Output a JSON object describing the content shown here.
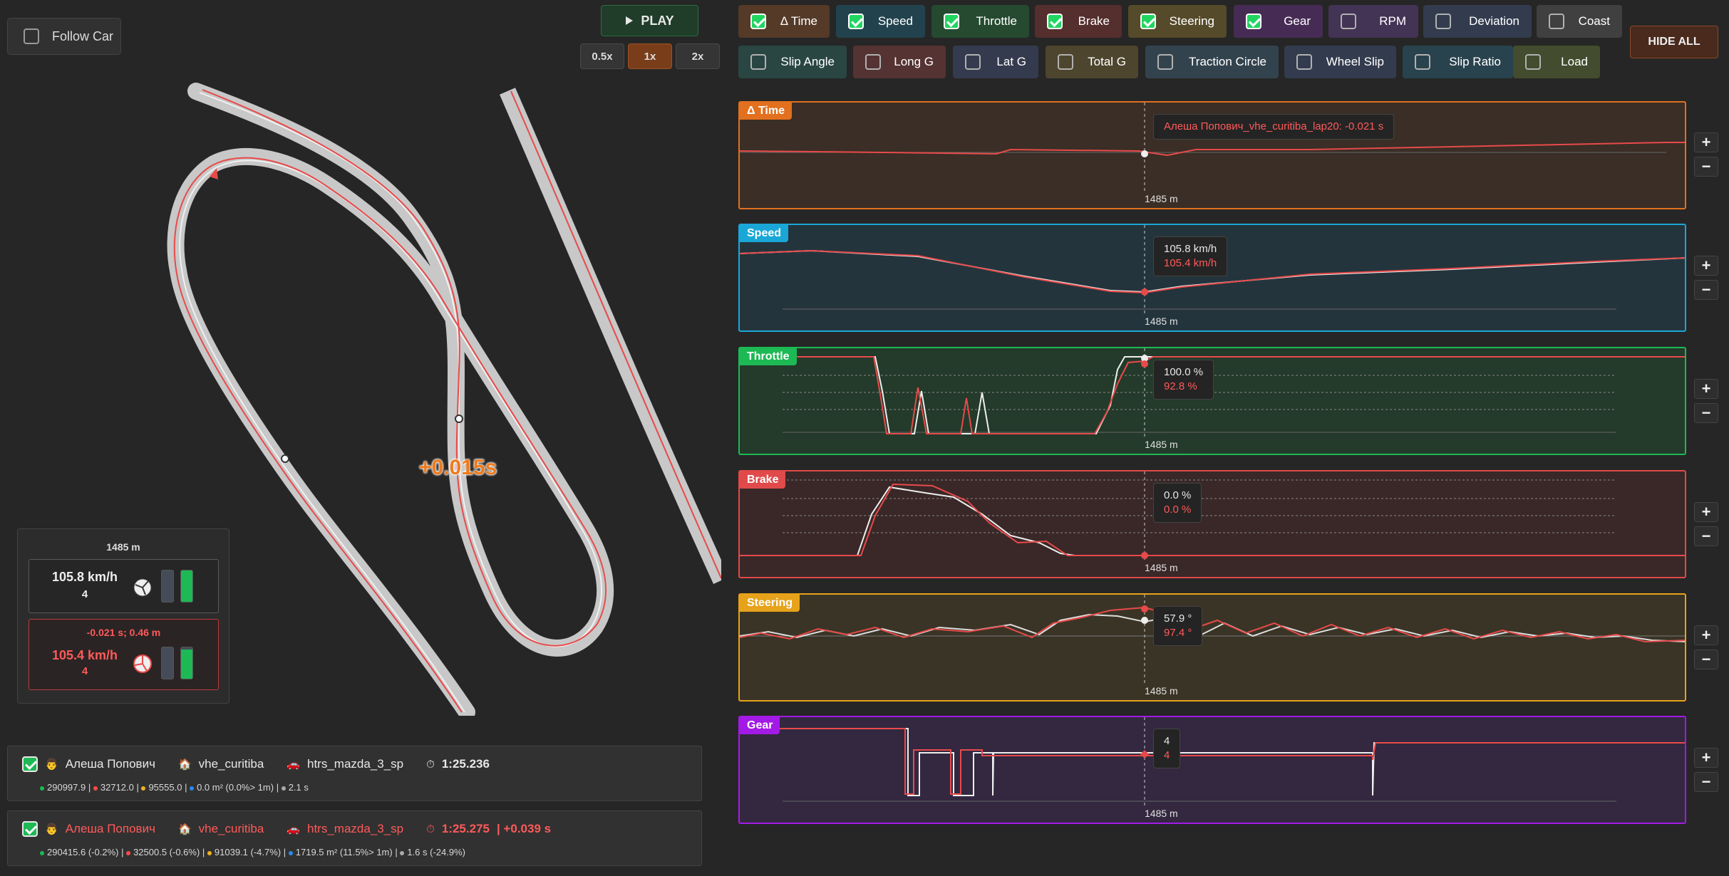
{
  "controls": {
    "follow_car_label": "Follow Car",
    "play_label": "PLAY",
    "play_icon": "play-icon",
    "speeds": [
      "0.5x",
      "1x",
      "2x"
    ],
    "active_speed": "1x",
    "hide_all_label": "HIDE ALL"
  },
  "channels": [
    {
      "label": "Δ Time",
      "checked": true,
      "color": "#4a3222"
    },
    {
      "label": "Speed",
      "checked": true,
      "color": "#1e3a44"
    },
    {
      "label": "Throttle",
      "checked": true,
      "color": "#20402a"
    },
    {
      "label": "Brake",
      "checked": true,
      "color": "#4a2828"
    },
    {
      "label": "Steering",
      "checked": true,
      "color": "#4a4024"
    },
    {
      "label": "Gear",
      "checked": true,
      "color": "#3d2649"
    },
    {
      "label": "RPM",
      "checked": false,
      "color": "#3a2c4a"
    },
    {
      "label": "Deviation",
      "checked": false,
      "color": "#2c3444"
    },
    {
      "label": "Coast",
      "checked": false,
      "color": "#383838"
    },
    {
      "label": "Slip Angle",
      "checked": false,
      "color": "#243d3a"
    },
    {
      "label": "Long G",
      "checked": false,
      "color": "#4a2c2c"
    },
    {
      "label": "Lat G",
      "checked": false,
      "color": "#2d3344"
    },
    {
      "label": "Total G",
      "checked": false,
      "color": "#443c28"
    },
    {
      "label": "Traction Circle",
      "checked": false,
      "color": "#2c3a44"
    },
    {
      "label": "Wheel Slip",
      "checked": false,
      "color": "#2c3444"
    },
    {
      "label": "Slip Ratio",
      "checked": false,
      "color": "#243a44"
    },
    {
      "label": "Load",
      "checked": false,
      "color": "#3a4228"
    }
  ],
  "track": {
    "delta_label": "+0.015s"
  },
  "info": {
    "distance": "1485 m",
    "car1": {
      "speed": "105.8 km/h",
      "gear": "4",
      "brake_level": 0,
      "throttle_level": 1.0
    },
    "car2": {
      "delta": "-0.021 s; 0.46 m",
      "speed": "105.4 km/h",
      "gear": "4",
      "brake_level": 0,
      "throttle_level": 0.93
    }
  },
  "laps": [
    {
      "checked": true,
      "driver": "Алеша Попович",
      "track": "vhe_curitiba",
      "car": "htrs_mazda_3_sp",
      "time": "1:25.236",
      "delta": "",
      "stats": [
        "290997.9",
        "32712.0",
        "95555.0",
        "0.0 m² (0.0%> 1m)",
        "2.1 s"
      ]
    },
    {
      "checked": true,
      "driver": "Алеша Попович",
      "track": "vhe_curitiba",
      "car": "htrs_mazda_3_sp",
      "time": "1:25.275",
      "delta": "| +0.039 s",
      "stats": [
        "290415.6 (-0.2%)",
        "32500.5 (-0.6%)",
        "91039.1 (-4.7%)",
        "1719.5 m² (11.5%> 1m)",
        "1.6 s (-24.9%)"
      ]
    }
  ],
  "stat_colors": [
    "#1db954",
    "#ff4a4a",
    "#f0b020",
    "#2a8af0",
    "#aaaaaa"
  ],
  "panels": [
    {
      "key": "delta",
      "title": "Δ Time",
      "xlabel": "1485 m",
      "tip_a": "",
      "tip_b": "Алеша Попович_vhe_curitiba_lap20: -0.021 s",
      "border": "#e2701e",
      "bg": "#3a2e26",
      "tag": "#e2701e"
    },
    {
      "key": "speed",
      "title": "Speed",
      "xlabel": "1485 m",
      "tip_a": "105.8 km/h",
      "tip_b": "105.4 km/h",
      "border": "#1aa7d8",
      "bg": "#24343c",
      "tag": "#1aa7d8"
    },
    {
      "key": "throttle",
      "title": "Throttle",
      "xlabel": "1485 m",
      "tip_a": "100.0 %",
      "tip_b": "92.8 %",
      "border": "#1db954",
      "bg": "#243a2a",
      "tag": "#1db954"
    },
    {
      "key": "brake",
      "title": "Brake",
      "xlabel": "1485 m",
      "tip_a": "0.0 %",
      "tip_b": "0.0 %",
      "border": "#e04a4a",
      "bg": "#3a2828",
      "tag": "#e04a4a"
    },
    {
      "key": "steering",
      "title": "Steering",
      "xlabel": "1485 m",
      "tip_a": "57.9 °",
      "tip_b": "97.4 °",
      "border": "#e6a21a",
      "bg": "#3a3426",
      "tag": "#e6a21a"
    },
    {
      "key": "gear",
      "title": "Gear",
      "xlabel": "1485 m",
      "tip_a": "4",
      "tip_b": "4",
      "border": "#a31ae6",
      "bg": "#332840",
      "tag": "#a31ae6"
    }
  ]
}
